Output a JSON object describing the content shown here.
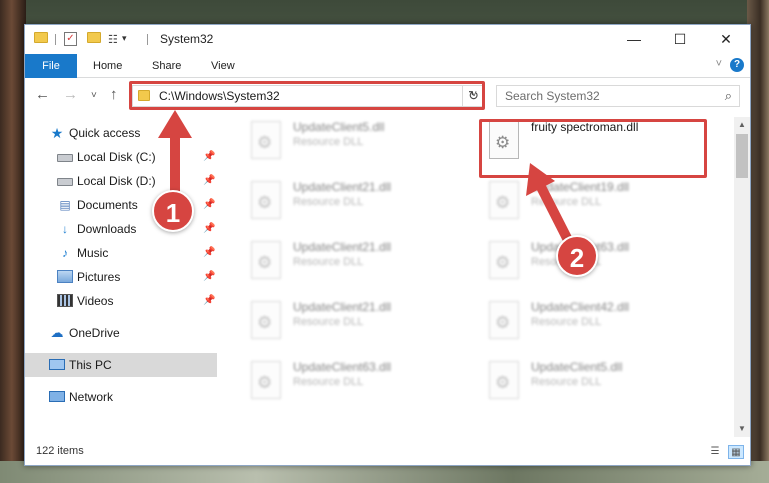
{
  "window": {
    "title": "System32",
    "minimize_glyph": "—",
    "maximize_glyph": "☐",
    "close_glyph": "✕"
  },
  "ribbon": {
    "tabs": [
      "File",
      "Home",
      "Share",
      "View"
    ],
    "expand_glyph": "˅",
    "help_glyph": "?"
  },
  "nav": {
    "back_glyph": "←",
    "forward_glyph": "→",
    "recent_glyph": "˅",
    "up_glyph": "↑",
    "address": "C:\\Windows\\System32",
    "address_drop": "˅",
    "refresh_glyph": "↻",
    "search_placeholder": "Search System32",
    "search_glyph": "⌕"
  },
  "sidebar": {
    "items": [
      {
        "label": "Quick access",
        "icon": "star-icon",
        "pinned": false
      },
      {
        "label": "Local Disk (C:)",
        "icon": "drive-icon",
        "pinned": true
      },
      {
        "label": "Local Disk (D:)",
        "icon": "drive-icon",
        "pinned": true
      },
      {
        "label": "Documents",
        "icon": "documents-icon",
        "pinned": true
      },
      {
        "label": "Downloads",
        "icon": "downloads-icon",
        "pinned": true
      },
      {
        "label": "Music",
        "icon": "music-icon",
        "pinned": true
      },
      {
        "label": "Pictures",
        "icon": "pictures-icon",
        "pinned": true
      },
      {
        "label": "Videos",
        "icon": "videos-icon",
        "pinned": true
      },
      {
        "label": "OneDrive",
        "icon": "cloud-icon",
        "pinned": false
      },
      {
        "label": "This PC",
        "icon": "computer-icon",
        "pinned": false,
        "selected": true
      },
      {
        "label": "Network",
        "icon": "network-icon",
        "pinned": false
      }
    ],
    "pin_glyph": "📌"
  },
  "files": {
    "left_column": [
      {
        "name": "UpdateClient5.dll",
        "type": "Resource DLL"
      },
      {
        "name": "UpdateClient21.dll",
        "type": "Resource DLL"
      },
      {
        "name": "UpdateClient21.dll",
        "type": "Resource DLL"
      },
      {
        "name": "UpdateClient21.dll",
        "type": "Resource DLL"
      },
      {
        "name": "UpdateClient63.dll",
        "type": "Resource DLL"
      }
    ],
    "right_column": [
      {
        "name": "fruity spectroman.dll",
        "type": "",
        "highlighted": true
      },
      {
        "name": "UpdateClient19.dll",
        "type": "Resource DLL"
      },
      {
        "name": "UpdateClient63.dll",
        "type": "Resource DLL"
      },
      {
        "name": "UpdateClient42.dll",
        "type": "Resource DLL"
      },
      {
        "name": "UpdateClient5.dll",
        "type": "Resource DLL"
      }
    ],
    "gear_glyph": "⚙"
  },
  "status": {
    "item_count": "122 items",
    "details_view_glyph": "☰",
    "icons_view_glyph": "▦"
  },
  "annotations": {
    "badge1": "1",
    "badge2": "2",
    "color": "#d64541"
  }
}
